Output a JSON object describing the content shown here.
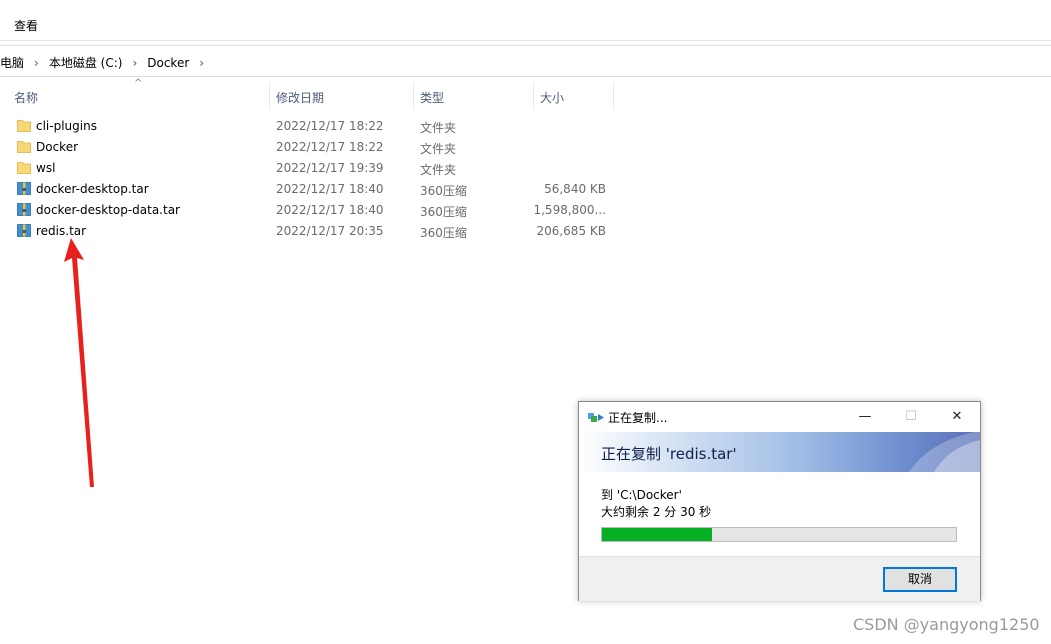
{
  "ribbon": {
    "tab": "查看"
  },
  "address": {
    "crumbs": [
      "电脑",
      "本地磁盘 (C:)",
      "Docker"
    ],
    "trailing_chevron": "›"
  },
  "columns": {
    "name": "名称",
    "date": "修改日期",
    "type": "类型",
    "size": "大小",
    "sort_indicator": "^"
  },
  "files": [
    {
      "name": "cli-plugins",
      "date": "2022/12/17 18:22",
      "type": "文件夹",
      "size": "",
      "icon": "folder-icon"
    },
    {
      "name": "Docker",
      "date": "2022/12/17 18:22",
      "type": "文件夹",
      "size": "",
      "icon": "folder-icon"
    },
    {
      "name": "wsl",
      "date": "2022/12/17 19:39",
      "type": "文件夹",
      "size": "",
      "icon": "folder-icon"
    },
    {
      "name": "docker-desktop.tar",
      "date": "2022/12/17 18:40",
      "type": "360压缩",
      "size": "56,840 KB",
      "icon": "archive-icon"
    },
    {
      "name": "docker-desktop-data.tar",
      "date": "2022/12/17 18:40",
      "type": "360压缩",
      "size": "1,598,800...",
      "icon": "archive-icon"
    },
    {
      "name": "redis.tar",
      "date": "2022/12/17 20:35",
      "type": "360压缩",
      "size": "206,685 KB",
      "icon": "archive-icon"
    }
  ],
  "annotation": {
    "color": "#e8211c"
  },
  "dialog": {
    "title": "正在复制...",
    "minimize": "—",
    "maximize": "☐",
    "close": "✕",
    "heading": "正在复制 'redis.tar'",
    "destination": "到 'C:\\Docker'",
    "remaining": "大约剩余 2 分 30 秒",
    "progress": 0.31,
    "progress_color": "#06b025",
    "cancel_label": "取消"
  },
  "watermark": "CSDN @yangyong1250"
}
